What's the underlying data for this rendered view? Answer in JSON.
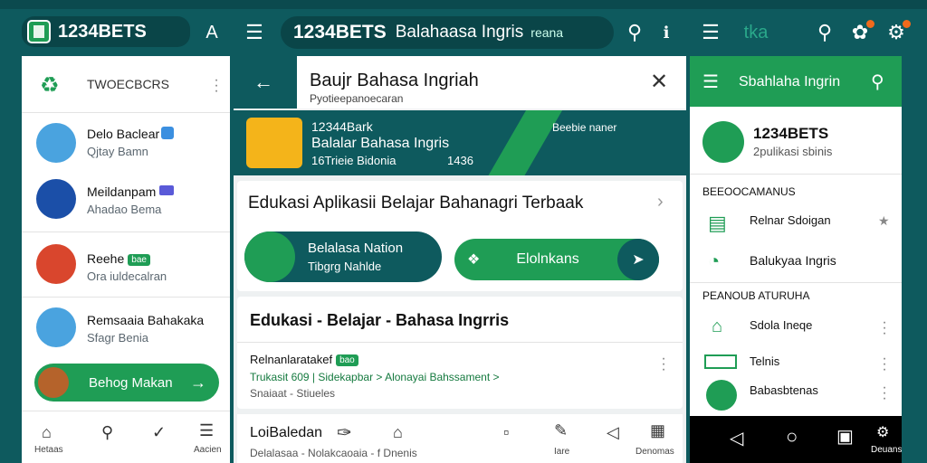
{
  "topbar": {
    "app_title": "1234BETS",
    "app_initial": "A",
    "tab_title": "1234BETS",
    "tab_subtitle": "Balahaasa Ingris",
    "tab_extra": "reana",
    "right_title": "tka"
  },
  "left_panel": {
    "header": "TWOECBCRS",
    "items": [
      {
        "title": "Delo Baclear",
        "sub": "Qjtay Bamn"
      },
      {
        "title": "Meildanpam",
        "sub": "Ahadao Bema"
      },
      {
        "title": "Reehe",
        "badge": "bae",
        "sub": "Ora iuldecalran"
      },
      {
        "title": "Remsaaia Bahakaka",
        "sub": "Sfagr Benia"
      }
    ],
    "cta_label": "Behog Makan",
    "nav": [
      {
        "icon": "home-icon",
        "label": "Hetaas"
      },
      {
        "icon": "search-icon",
        "label": ""
      },
      {
        "icon": "mail-icon",
        "label": ""
      },
      {
        "icon": "menu-icon",
        "label": "Aacien"
      }
    ]
  },
  "center_panel": {
    "header_title": "Baujr Bahasa Ingriah",
    "header_sub": "Pyotieepanoecaran",
    "hero_line1": "12344Bark",
    "hero_line2": "Balalar Bahasa Ingris",
    "hero_line3": "16Trieie Bidonia",
    "hero_count": "1436",
    "hero_right": "Beebie naner",
    "card1_title": "Edukasi  Aplikasii Belajar Bahanagri Terbaak",
    "card1_btn1_line1": "Belalasa Nation",
    "card1_btn1_line2": "Tibgrg Nahlde",
    "card1_btn2": "Elolnkans",
    "card2_title": "Edukasi - Belajar - Bahasa Ingrris",
    "card2_item_title": "Relnanlaratakef",
    "card2_item_badge": "bao",
    "card2_item_link": "Trukasit 609 | Sidekapbar >  Alonayai Bahssament >",
    "card2_item_sub": "Snaiaat - Stiueles",
    "bottom_title": "LoiBaledan",
    "bottom_sub": "Delalasaa - Nolakcaoaia - f Dnenis",
    "bottom_labels": [
      "Iare",
      "Denomas"
    ]
  },
  "right_panel": {
    "header_title": "Sbahlaha Ingrin",
    "profile_title": "1234BETS",
    "profile_sub": "2pulikasi sbinis",
    "section1": "BEEOOCAMANUS",
    "section1_items": [
      "Relnar Sdoigan",
      "Balukyaa Ingris"
    ],
    "section2": "PEANOUB ATURUHA",
    "section2_items": [
      "Sdola Ineqe",
      "Telnis",
      "Babasbtenas"
    ],
    "nav_label": "Deuans"
  },
  "colors": {
    "brand_teal": "#0e5a5e",
    "accent_green": "#1f9d55"
  }
}
